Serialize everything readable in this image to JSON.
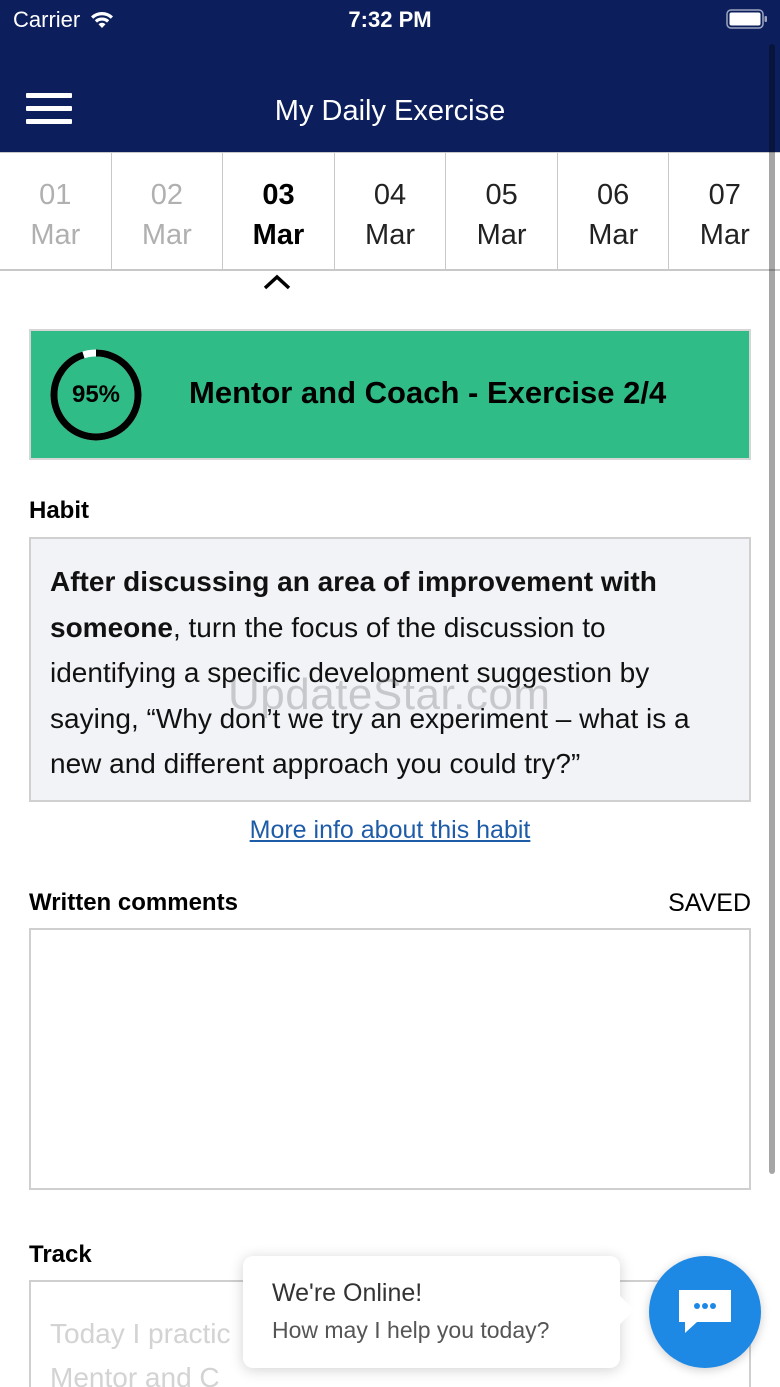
{
  "status_bar": {
    "carrier": "Carrier",
    "time": "7:32 PM"
  },
  "header": {
    "title": "My Daily Exercise",
    "menu_icon": "hamburger-menu-icon"
  },
  "dates": [
    {
      "day": "01",
      "month": "Mar",
      "state": "past"
    },
    {
      "day": "02",
      "month": "Mar",
      "state": "past"
    },
    {
      "day": "03",
      "month": "Mar",
      "state": "selected"
    },
    {
      "day": "04",
      "month": "Mar",
      "state": "future"
    },
    {
      "day": "05",
      "month": "Mar",
      "state": "future"
    },
    {
      "day": "06",
      "month": "Mar",
      "state": "future"
    },
    {
      "day": "07",
      "month": "Mar",
      "state": "future"
    }
  ],
  "progress_card": {
    "percent_label": "95%",
    "progress": 0.95,
    "title": "Mentor and Coach - Exercise 2/4",
    "color": "#30bc86"
  },
  "habit": {
    "label": "Habit",
    "bold_text": "After discussing an area of improvement with someone",
    "text": ", turn the focus of the discussion to identifying a specific development suggestion by saying, “Why don’t we try an experiment – what is a new and different approach you could try?”",
    "more_link": "More info about this habit"
  },
  "watermark": "UpdateStar.com",
  "comments": {
    "label": "Written comments",
    "status": "SAVED",
    "value": ""
  },
  "track": {
    "label": "Track",
    "placeholder_line1": "Today I practic",
    "placeholder_line2": "Mentor and C"
  },
  "chat": {
    "title": "We're Online!",
    "subtitle": "How may I help you today?",
    "icon": "chat-icon",
    "color": "#1e88e5"
  },
  "colors": {
    "header_bg": "#0c1f5c",
    "link": "#1f5ca8"
  }
}
